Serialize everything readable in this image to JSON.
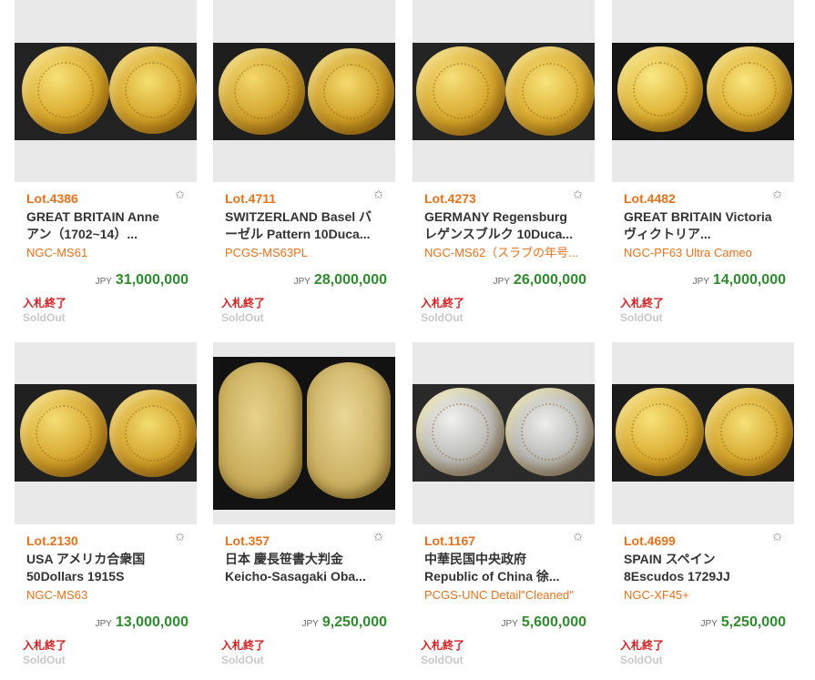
{
  "lots": [
    {
      "lot": "Lot.4386",
      "title1": "GREAT BRITAIN Anne",
      "title2": "アン（1702~14）...",
      "grade": "NGC-MS61",
      "currency": "JPY",
      "price": "31,000,000",
      "status": "入札終了",
      "sold": "SoldOut"
    },
    {
      "lot": "Lot.4711",
      "title1": "SWITZERLAND Basel バ",
      "title2": "ーゼル Pattern 10Duca...",
      "grade": "PCGS-MS63PL",
      "currency": "JPY",
      "price": "28,000,000",
      "status": "入札終了",
      "sold": "SoldOut"
    },
    {
      "lot": "Lot.4273",
      "title1": "GERMANY Regensburg",
      "title2": "レゲンスブルク 10Duca...",
      "grade": "NGC-MS62（スラブの年号...",
      "currency": "JPY",
      "price": "26,000,000",
      "status": "入札終了",
      "sold": "SoldOut"
    },
    {
      "lot": "Lot.4482",
      "title1": "GREAT BRITAIN Victoria",
      "title2": "ヴィクトリア...",
      "grade": "NGC-PF63 Ultra Cameo",
      "currency": "JPY",
      "price": "14,000,000",
      "status": "入札終了",
      "sold": "SoldOut"
    },
    {
      "lot": "Lot.2130",
      "title1": "USA アメリカ合衆国",
      "title2": "50Dollars 1915S",
      "grade": "NGC-MS63",
      "currency": "JPY",
      "price": "13,000,000",
      "status": "入札終了",
      "sold": "SoldOut"
    },
    {
      "lot": "Lot.357",
      "title1": "日本 慶長笹書大判金",
      "title2": "Keicho-Sasagaki Oba...",
      "grade": "",
      "currency": "JPY",
      "price": "9,250,000",
      "status": "入札終了",
      "sold": "SoldOut"
    },
    {
      "lot": "Lot.1167",
      "title1": "中華民国中央政府",
      "title2": "Republic of China 徐...",
      "grade": "PCGS-UNC Detail\"Cleaned\"",
      "currency": "JPY",
      "price": "5,600,000",
      "status": "入札終了",
      "sold": "SoldOut"
    },
    {
      "lot": "Lot.4699",
      "title1": "SPAIN スペイン",
      "title2": "8Escudos 1729JJ",
      "grade": "NGC-XF45+",
      "currency": "JPY",
      "price": "5,250,000",
      "status": "入札終了",
      "sold": "SoldOut"
    }
  ]
}
